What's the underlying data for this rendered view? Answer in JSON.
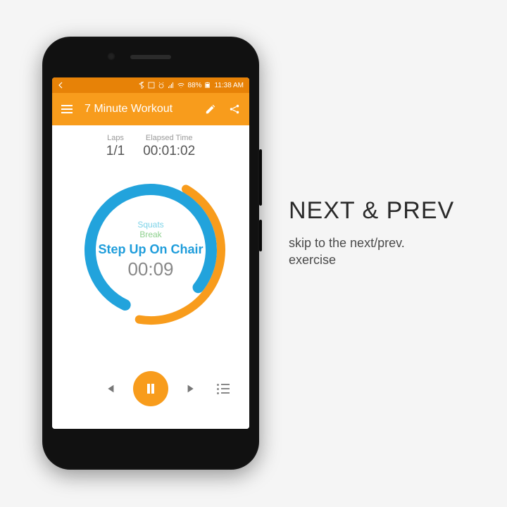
{
  "statusbar": {
    "battery_pct": "88%",
    "time": "11:38 AM"
  },
  "appbar": {
    "title": "7 Minute Workout"
  },
  "stats": {
    "laps_label": "Laps",
    "laps_value": "1/1",
    "elapsed_label": "Elapsed Time",
    "elapsed_value": "00:01:02"
  },
  "ring": {
    "prev_exercise": "Squats",
    "break_label": "Break",
    "current_exercise": "Step Up On Chair",
    "countdown": "00:09"
  },
  "colors": {
    "accent_orange": "#f89c1c",
    "accent_blue": "#1f9ddb",
    "ring_blue": "#22a3dc",
    "ring_orange": "#f89c1c"
  },
  "marketing": {
    "heading": "NEXT & PREV",
    "body_line1": "skip to the next/prev.",
    "body_line2": "exercise"
  }
}
